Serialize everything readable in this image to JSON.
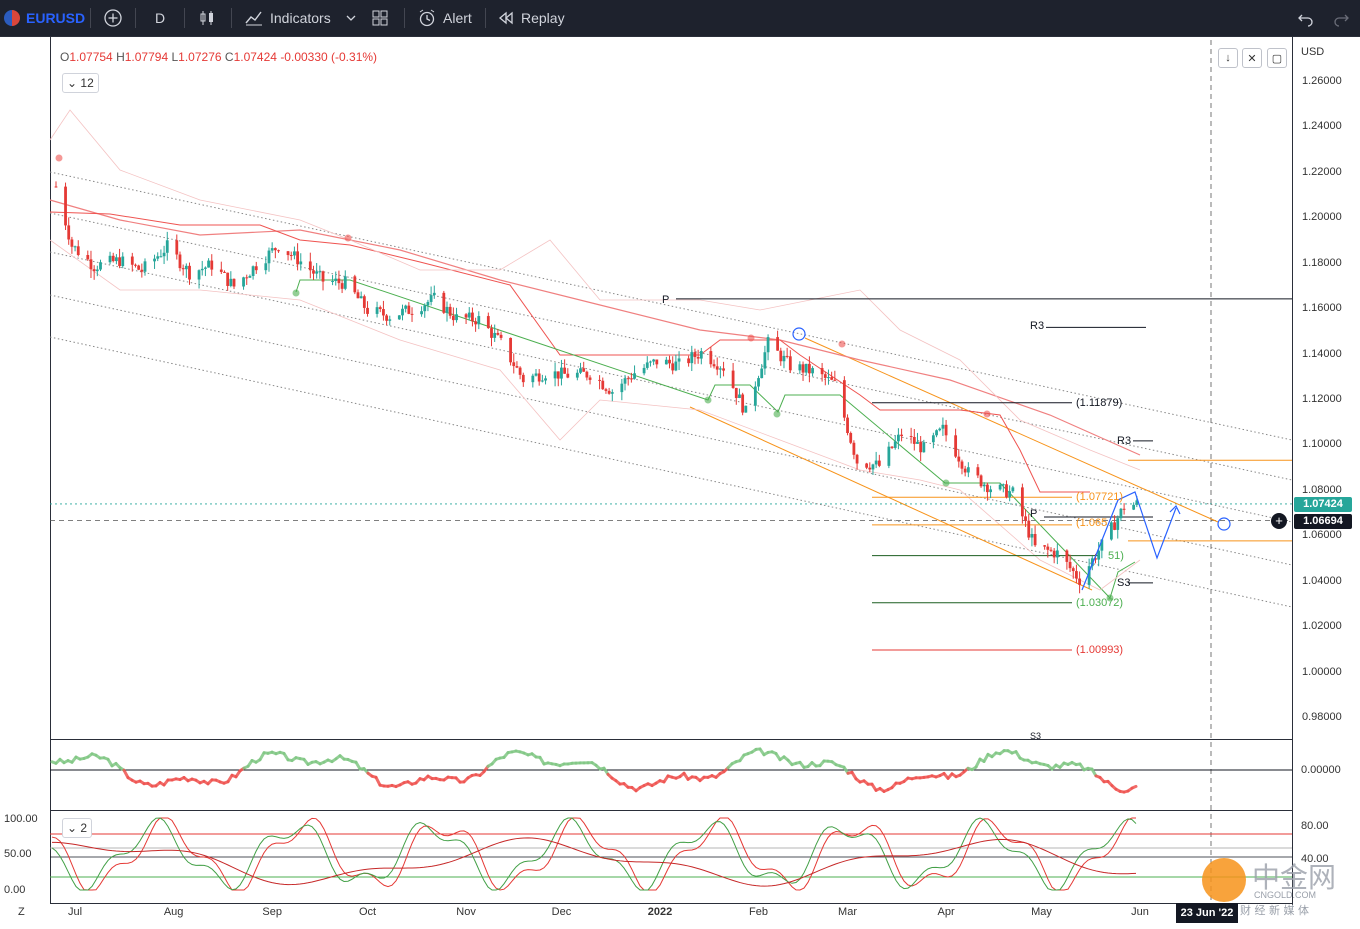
{
  "toolbar": {
    "symbol": "EURUSD",
    "interval": "D",
    "indicators_label": "Indicators",
    "alert_label": "Alert",
    "replay_label": "Replay"
  },
  "legend": {
    "open_key": "O",
    "open": "1.07754",
    "high_key": "H",
    "high": "1.07794",
    "low_key": "L",
    "low": "1.07276",
    "close_key": "C",
    "close": "1.07424",
    "change": "-0.00330 (-0.31%)",
    "collapse_count": "12"
  },
  "price_axis": {
    "currency": "USD",
    "labels": [
      "1.26000",
      "1.24000",
      "1.22000",
      "1.20000",
      "1.18000",
      "1.16000",
      "1.14000",
      "1.12000",
      "1.10000",
      "1.08000",
      "1.06000",
      "1.04000",
      "1.02000",
      "1.00000",
      "0.98000"
    ],
    "last_price": "1.07424",
    "crosshair_price": "1.06694"
  },
  "time_axis": {
    "labels": [
      "Jul",
      "Aug",
      "Sep",
      "Oct",
      "Nov",
      "Dec",
      "2022",
      "Feb",
      "Mar",
      "Apr",
      "May",
      "Jun"
    ],
    "crosshair_date": "23 Jun '22"
  },
  "annotations": {
    "pivot_p_upper": "P",
    "r3_upper": "R3",
    "fib_1": "(1.11879)",
    "r3_lower": "R3",
    "fib_2": "(1.07721)",
    "pivot_p_lower": "P",
    "fib_3": "(1.065",
    "fib_4": "51)",
    "s3": "S3",
    "fib_5": "(1.03072)",
    "fib_6": "(1.00993)",
    "s3_bottom": "S3"
  },
  "osc1": {
    "zero_label": "0.00000"
  },
  "osc2": {
    "count": "2",
    "left_labels": [
      "100.00",
      "50.00",
      "0.00"
    ],
    "right_labels": [
      "80.00",
      "40.00"
    ]
  },
  "bottom_left": {
    "z_label": "Z"
  },
  "watermark": {
    "name": "中金网",
    "sub": "CNGOLD.COM",
    "slogan": "财 经 新 媒 体"
  },
  "colors": {
    "up": "#26a69a",
    "down": "#e53935",
    "accent": "#2962ff",
    "fib_orange": "#f7931a",
    "green_line": "#4caf50"
  },
  "chart_data": {
    "type": "candlestick",
    "symbol": "EURUSD",
    "timeframe": "D",
    "ylim": [
      0.97,
      1.27
    ],
    "last": 1.07424,
    "key_levels": {
      "pivot_upper": 1.1645,
      "r3_upper": 1.152,
      "fib_1": 1.11879,
      "r3_lower": 1.102,
      "fib_2": 1.07721,
      "pivot_lower": 1.0685,
      "fib_3": 1.065,
      "fib_5": 1.03072,
      "fib_6": 1.00993,
      "s3": 1.0395,
      "orange_h1": 1.0935,
      "orange_h2": 1.058
    },
    "close_path": [
      [
        "2021-06-25",
        1.214
      ],
      [
        "2021-06-30",
        1.188
      ],
      [
        "2021-07-07",
        1.179
      ],
      [
        "2021-07-15",
        1.1815
      ],
      [
        "2021-07-22",
        1.177
      ],
      [
        "2021-07-30",
        1.1875
      ],
      [
        "2021-08-06",
        1.176
      ],
      [
        "2021-08-13",
        1.1795
      ],
      [
        "2021-08-20",
        1.17
      ],
      [
        "2021-08-27",
        1.1795
      ],
      [
        "2021-09-03",
        1.188
      ],
      [
        "2021-09-10",
        1.181
      ],
      [
        "2021-09-17",
        1.1725
      ],
      [
        "2021-09-24",
        1.1715
      ],
      [
        "2021-10-01",
        1.1595
      ],
      [
        "2021-10-08",
        1.157
      ],
      [
        "2021-10-15",
        1.16
      ],
      [
        "2021-10-22",
        1.1645
      ],
      [
        "2021-10-29",
        1.156
      ],
      [
        "2021-11-05",
        1.1555
      ],
      [
        "2021-11-12",
        1.145
      ],
      [
        "2021-11-19",
        1.129
      ],
      [
        "2021-11-26",
        1.132
      ],
      [
        "2021-12-03",
        1.131
      ],
      [
        "2021-12-10",
        1.1315
      ],
      [
        "2021-12-17",
        1.124
      ],
      [
        "2021-12-24",
        1.132
      ],
      [
        "2021-12-31",
        1.137
      ],
      [
        "2022-01-07",
        1.1355
      ],
      [
        "2022-01-14",
        1.141
      ],
      [
        "2022-01-21",
        1.1345
      ],
      [
        "2022-01-28",
        1.1145
      ],
      [
        "2022-02-04",
        1.145
      ],
      [
        "2022-02-11",
        1.135
      ],
      [
        "2022-02-18",
        1.1325
      ],
      [
        "2022-02-25",
        1.127
      ],
      [
        "2022-03-04",
        1.093
      ],
      [
        "2022-03-11",
        1.091
      ],
      [
        "2022-03-18",
        1.105
      ],
      [
        "2022-03-25",
        1.0985
      ],
      [
        "2022-03-31",
        1.107
      ],
      [
        "2022-04-08",
        1.088
      ],
      [
        "2022-04-15",
        1.0815
      ],
      [
        "2022-04-22",
        1.079
      ],
      [
        "2022-04-29",
        1.055
      ],
      [
        "2022-05-06",
        1.0525
      ],
      [
        "2022-05-13",
        1.041
      ],
      [
        "2022-05-20",
        1.056
      ],
      [
        "2022-05-27",
        1.073
      ],
      [
        "2022-05-31",
        1.0742
      ]
    ]
  }
}
